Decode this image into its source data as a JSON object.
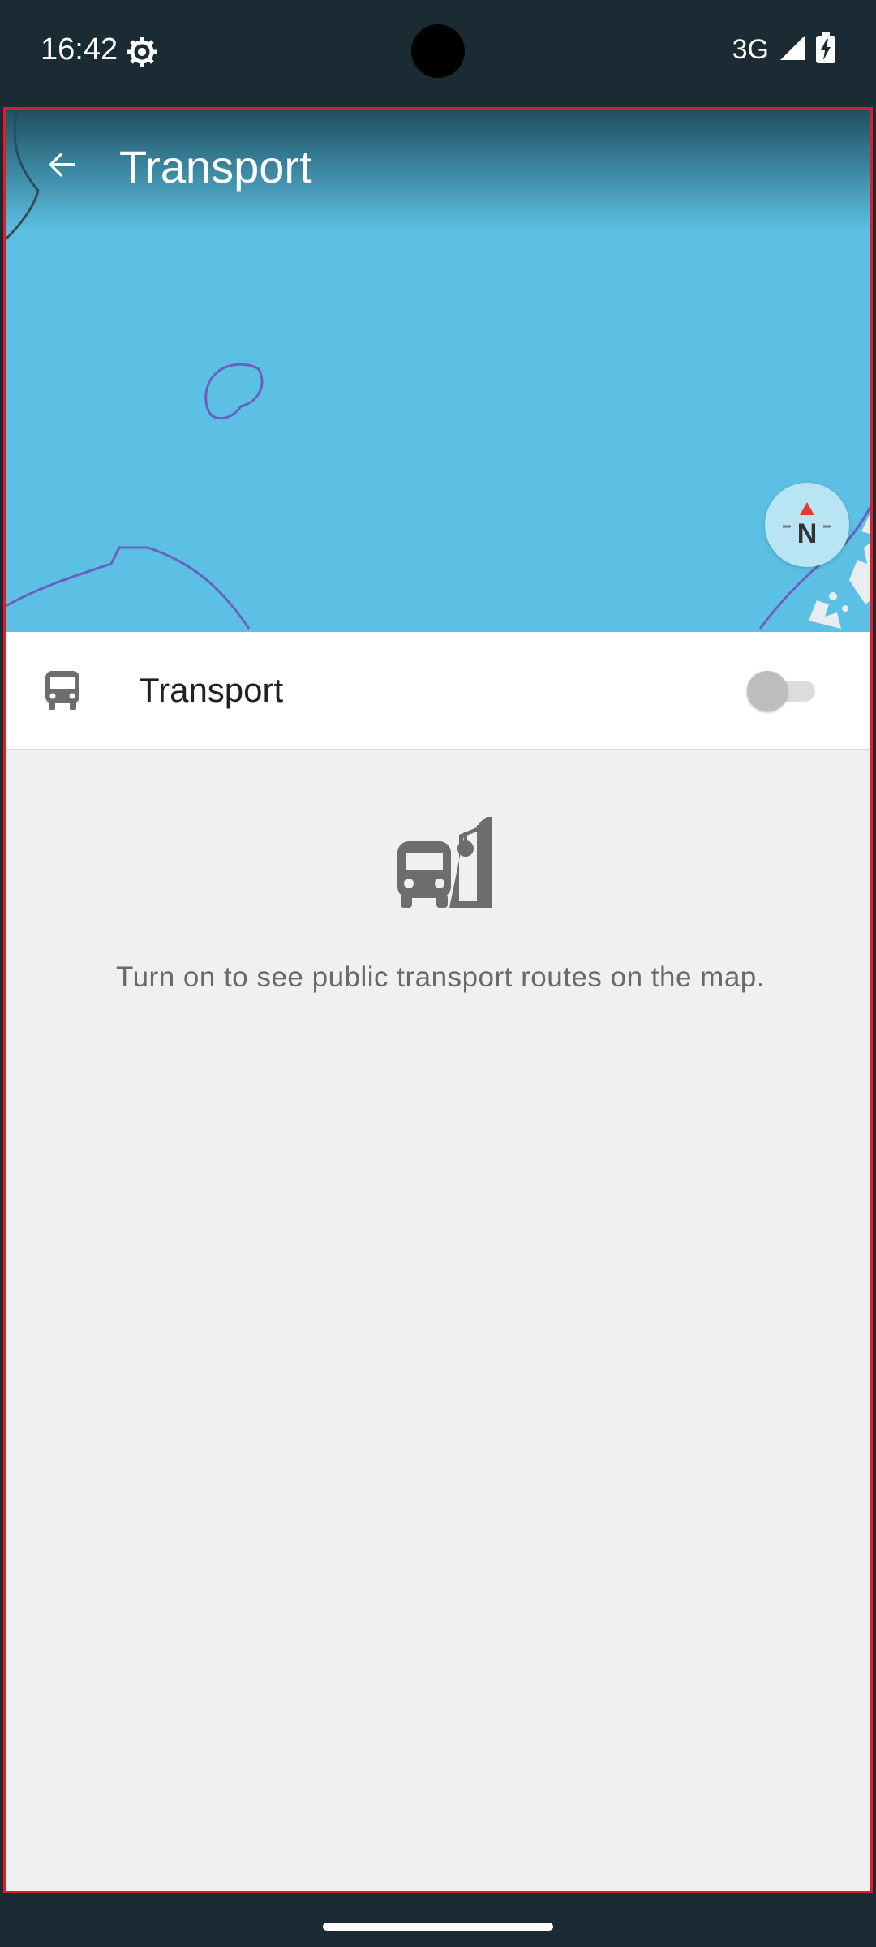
{
  "status_bar": {
    "time": "16:42",
    "network": "3G",
    "icons": [
      "settings-gear-icon",
      "signal-icon",
      "battery-charging-icon"
    ]
  },
  "toolbar": {
    "title": "Transport",
    "back_icon": "arrow-back-icon"
  },
  "map": {
    "compass_label": "N",
    "water_color": "#5bc0e3"
  },
  "transport_row": {
    "label": "Transport",
    "icon": "bus-icon",
    "enabled": false
  },
  "empty_state": {
    "icon": "bus-stop-icon",
    "message": "Turn on to see public transport routes on the map."
  },
  "colors": {
    "accent_border": "#e01c24",
    "icon_gray": "#6d6d6d"
  }
}
